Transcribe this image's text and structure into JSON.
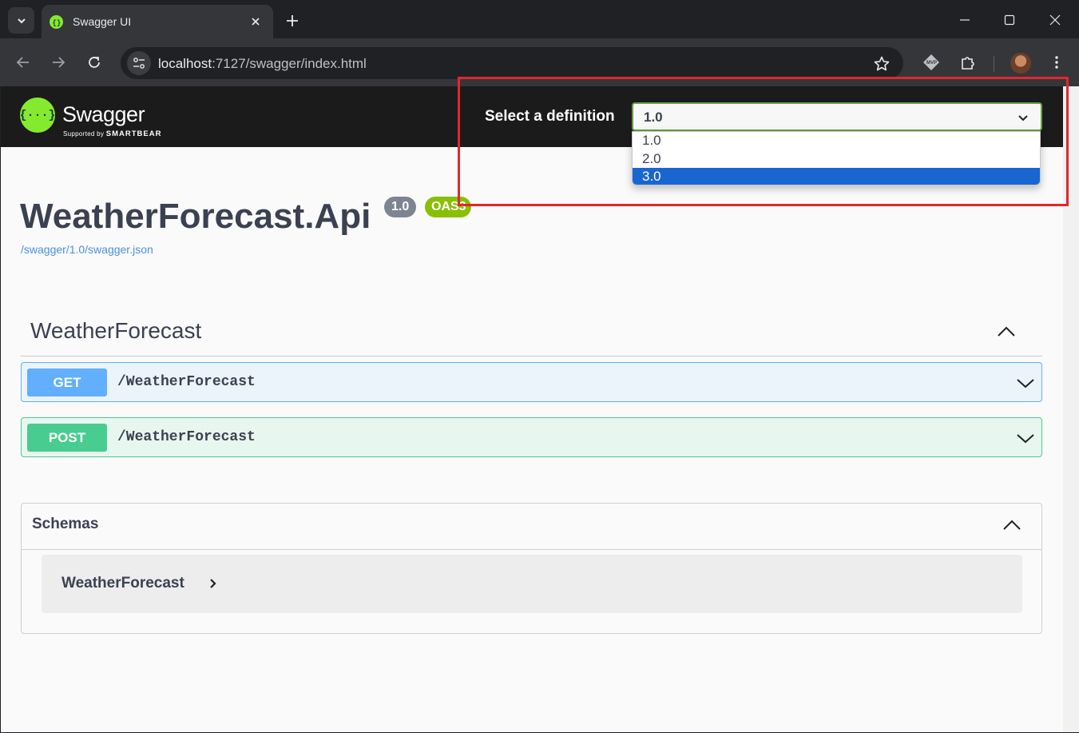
{
  "browser": {
    "tab_title": "Swagger UI",
    "url": {
      "host": "localhost",
      "rest": ":7127/swagger/index.html"
    }
  },
  "swagger": {
    "brand": "Swagger",
    "brand_sub_prefix": "Supported by",
    "brand_sub_company": "SMARTBEAR",
    "select_label": "Select a definition",
    "selected_definition": "1.0",
    "definition_options": [
      "1.0",
      "2.0",
      "3.0"
    ],
    "highlighted_option_index": 2
  },
  "info": {
    "title": "WeatherForecast.Api",
    "version_badge": "1.0",
    "oas_badge": "OAS3",
    "spec_url": "/swagger/1.0/swagger.json"
  },
  "tag": {
    "name": "WeatherForecast",
    "operations": [
      {
        "method": "GET",
        "path": "/WeatherForecast"
      },
      {
        "method": "POST",
        "path": "/WeatherForecast"
      }
    ]
  },
  "schemas": {
    "title": "Schemas",
    "models": [
      "WeatherForecast"
    ]
  },
  "colors": {
    "get": "#61affe",
    "post": "#49cc90",
    "swagger_green": "#85ea2d",
    "highlight_box": "#e3262e",
    "selected_option": "#1a66d1"
  }
}
